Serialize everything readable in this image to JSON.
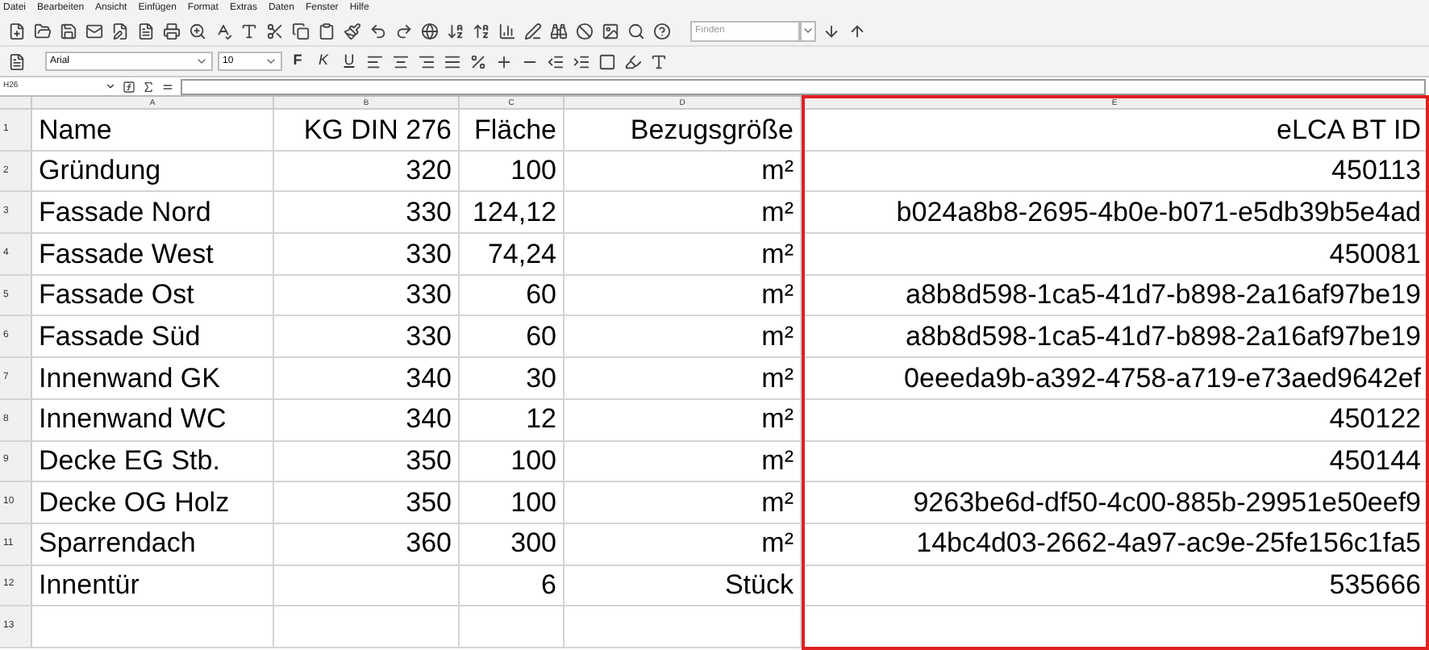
{
  "menu": [
    "Datei",
    "Bearbeiten",
    "Ansicht",
    "Einfügen",
    "Format",
    "Extras",
    "Daten",
    "Fenster",
    "Hilfe"
  ],
  "find": {
    "placeholder": "Finden"
  },
  "format_bar": {
    "font": "Arial",
    "size": "10",
    "style_buttons": [
      "F",
      "K",
      "U"
    ]
  },
  "formula_bar": {
    "cell_ref": "H26"
  },
  "columns": [
    {
      "letter": "A",
      "highlighted": false
    },
    {
      "letter": "B",
      "highlighted": false
    },
    {
      "letter": "C",
      "highlighted": false
    },
    {
      "letter": "D",
      "highlighted": false
    },
    {
      "letter": "E",
      "highlighted": true
    }
  ],
  "rows": [
    {
      "number": "1",
      "cells": [
        "Name",
        "KG DIN 276",
        "Fläche",
        "Bezugsgröße",
        "eLCA BT ID"
      ]
    },
    {
      "number": "2",
      "cells": [
        "Gründung",
        "320",
        "100",
        "m²",
        "450113"
      ]
    },
    {
      "number": "3",
      "cells": [
        "Fassade Nord",
        "330",
        "124,12",
        "m²",
        "b024a8b8-2695-4b0e-b071-e5db39b5e4ad"
      ]
    },
    {
      "number": "4",
      "cells": [
        "Fassade West",
        "330",
        "74,24",
        "m²",
        "450081"
      ]
    },
    {
      "number": "5",
      "cells": [
        "Fassade Ost",
        "330",
        "60",
        "m²",
        "a8b8d598-1ca5-41d7-b898-2a16af97be19"
      ]
    },
    {
      "number": "6",
      "cells": [
        "Fassade Süd",
        "330",
        "60",
        "m²",
        "a8b8d598-1ca5-41d7-b898-2a16af97be19"
      ]
    },
    {
      "number": "7",
      "cells": [
        "Innenwand GK",
        "340",
        "30",
        "m²",
        "0eeeda9b-a392-4758-a719-e73aed9642ef"
      ]
    },
    {
      "number": "8",
      "cells": [
        "Innenwand WC",
        "340",
        "12",
        "m²",
        "450122"
      ]
    },
    {
      "number": "9",
      "cells": [
        "Decke EG Stb.",
        "350",
        "100",
        "m²",
        "450144"
      ]
    },
    {
      "number": "10",
      "cells": [
        "Decke OG Holz",
        "350",
        "100",
        "m²",
        "9263be6d-df50-4c00-885b-29951e50eef9"
      ]
    },
    {
      "number": "11",
      "cells": [
        "Sparrendach",
        "360",
        "300",
        "m²",
        "14bc4d03-2662-4a97-ac9e-25fe156c1fa5"
      ]
    },
    {
      "number": "12",
      "cells": [
        "Innentür",
        null,
        "6",
        "Stück",
        "535666"
      ]
    },
    {
      "number": "13"
    }
  ]
}
